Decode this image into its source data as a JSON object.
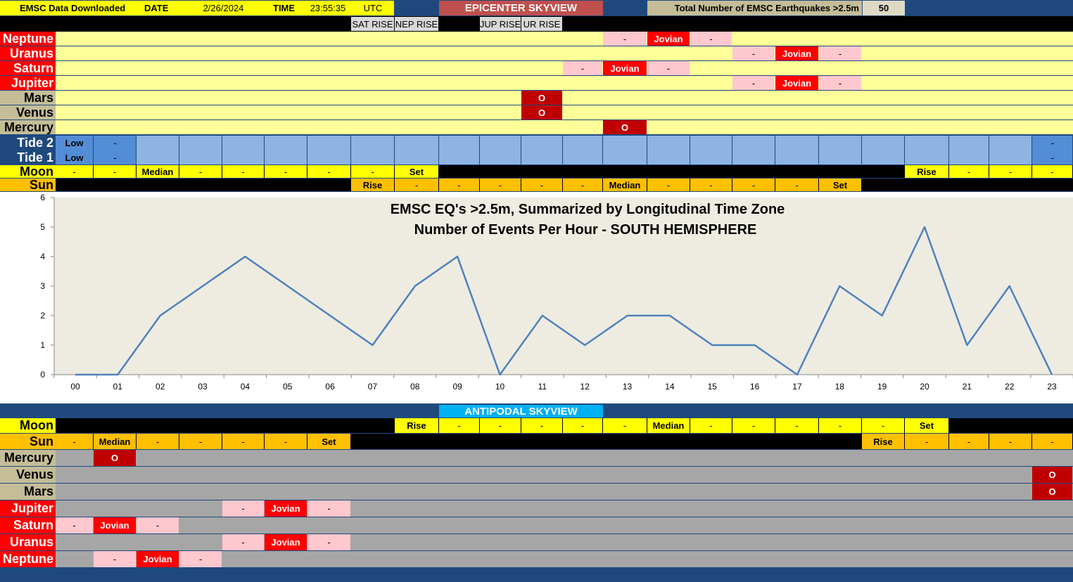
{
  "header": {
    "downloaded_label": "EMSC Data Downloaded",
    "date_label": "DATE",
    "date_value": "2/26/2024",
    "time_label": "TIME",
    "time_value": "23:55:35",
    "tz": "UTC",
    "title": "EPICENTER SKYVIEW",
    "total_label": "Total Number of EMSC Earthquakes >2.5m",
    "total_value": "50"
  },
  "rise_labels": [
    {
      "text": "SAT RISE",
      "col": 7
    },
    {
      "text": "NEP RISE",
      "col": 8
    },
    {
      "text": "JUP RISE",
      "col": 10
    },
    {
      "text": "UR RISE",
      "col": 11
    }
  ],
  "colors": {
    "navy": "#1F497D",
    "planet_red": "#FF0000",
    "tan": "#C4BD97",
    "band_yellow": "#FFFF99",
    "jovian_pink": "#FFC7CE",
    "conj_red": "#C00000",
    "tide_blue": "#8DB4E2",
    "tide_dark": "#538DD5",
    "moon_yellow": "#FFFF00",
    "sun_orange": "#FFC000",
    "antipodal_gray": "#A6A6A6",
    "antipodal_title": "#00B0F0",
    "line": "#4F81BD"
  },
  "epicenter": {
    "planets": [
      {
        "label": "Neptune",
        "cells": [
          {
            "col": 13,
            "text": "-",
            "kind": "pink"
          },
          {
            "col": 14,
            "text": "Jovian",
            "kind": "red"
          },
          {
            "col": 15,
            "text": "-",
            "kind": "pink"
          }
        ]
      },
      {
        "label": "Uranus",
        "cells": [
          {
            "col": 16,
            "text": "-",
            "kind": "pink"
          },
          {
            "col": 17,
            "text": "Jovian",
            "kind": "red"
          },
          {
            "col": 18,
            "text": "-",
            "kind": "pink"
          }
        ]
      },
      {
        "label": "Saturn",
        "cells": [
          {
            "col": 12,
            "text": "-",
            "kind": "pink"
          },
          {
            "col": 13,
            "text": "Jovian",
            "kind": "red"
          },
          {
            "col": 14,
            "text": "-",
            "kind": "pink"
          }
        ]
      },
      {
        "label": "Jupiter",
        "cells": [
          {
            "col": 16,
            "text": "-",
            "kind": "pink"
          },
          {
            "col": 17,
            "text": "Jovian",
            "kind": "red"
          },
          {
            "col": 18,
            "text": "-",
            "kind": "pink"
          }
        ]
      },
      {
        "label": "Mars",
        "cells": [
          {
            "col": 11,
            "text": "O",
            "kind": "conj"
          }
        ]
      },
      {
        "label": "Venus",
        "cells": [
          {
            "col": 11,
            "text": "O",
            "kind": "conj"
          }
        ]
      },
      {
        "label": "Mercury",
        "cells": [
          {
            "col": 13,
            "text": "O",
            "kind": "conj"
          }
        ]
      }
    ],
    "tide2_label": "Tide 2",
    "tide1_label": "Tide 1",
    "tide_low": "Low",
    "tide_dash_cols": [
      1,
      23
    ],
    "moon_label": "Moon",
    "moon": [
      "-",
      "-",
      "Median",
      "-",
      "-",
      "-",
      "-",
      "-",
      "Set",
      "",
      "",
      "",
      "",
      "",
      "",
      "",
      "",
      "",
      "",
      "",
      "Rise",
      "-",
      "-",
      "-"
    ],
    "sun_label": "Sun",
    "sun": [
      "",
      "",
      "",
      "",
      "",
      "",
      "",
      "Rise",
      "-",
      "-",
      "-",
      "-",
      "-",
      "Median",
      "-",
      "-",
      "-",
      "-",
      "Set",
      "",
      "",
      "",
      "",
      ""
    ]
  },
  "chart_data": {
    "type": "line",
    "title": "EMSC EQ's >2.5m, Summarized by Longitudinal Time Zone",
    "subtitle": "Number of Events Per Hour - SOUTH HEMISPHERE",
    "categories": [
      "00",
      "01",
      "02",
      "03",
      "04",
      "05",
      "06",
      "07",
      "08",
      "09",
      "10",
      "11",
      "12",
      "13",
      "14",
      "15",
      "16",
      "17",
      "18",
      "19",
      "20",
      "21",
      "22",
      "23"
    ],
    "values": [
      0,
      0,
      2,
      3,
      4,
      3,
      2,
      1,
      3,
      4,
      0,
      2,
      1,
      2,
      2,
      1,
      1,
      0,
      3,
      2,
      5,
      1,
      3,
      0
    ],
    "yticks": [
      "0",
      "1",
      "2",
      "3",
      "4",
      "5",
      "6"
    ],
    "ylim": [
      0,
      6
    ],
    "grid": false,
    "legend": "none"
  },
  "antipodal": {
    "title": "ANTIPODAL SKYVIEW",
    "moon_label": "Moon",
    "moon": [
      "",
      "",
      "",
      "",
      "",
      "",
      "",
      "",
      "Rise",
      "-",
      "-",
      "-",
      "-",
      "-",
      "Median",
      "-",
      "-",
      "-",
      "-",
      "-",
      "Set",
      "",
      "",
      ""
    ],
    "sun_label": "Sun",
    "sun": [
      "-",
      "Median",
      "-",
      "-",
      "-",
      "-",
      "Set",
      "",
      "",
      "",
      "",
      "",
      "",
      "",
      "",
      "",
      "",
      "",
      "",
      "Rise",
      "-",
      "-",
      "-",
      "-"
    ],
    "planets": [
      {
        "label": "Mercury",
        "cells": [
          {
            "col": 1,
            "text": "O",
            "kind": "conj"
          }
        ]
      },
      {
        "label": "Venus",
        "cells": [
          {
            "col": 23,
            "text": "O",
            "kind": "conj"
          }
        ]
      },
      {
        "label": "Mars",
        "cells": [
          {
            "col": 23,
            "text": "O",
            "kind": "conj"
          }
        ]
      },
      {
        "label": "Jupiter",
        "cells": [
          {
            "col": 4,
            "text": "-",
            "kind": "pink"
          },
          {
            "col": 5,
            "text": "Jovian",
            "kind": "red"
          },
          {
            "col": 6,
            "text": "-",
            "kind": "pink"
          }
        ]
      },
      {
        "label": "Saturn",
        "cells": [
          {
            "col": 0,
            "text": "-",
            "kind": "pink"
          },
          {
            "col": 1,
            "text": "Jovian",
            "kind": "red"
          },
          {
            "col": 2,
            "text": "-",
            "kind": "pink"
          }
        ]
      },
      {
        "label": "Uranus",
        "cells": [
          {
            "col": 4,
            "text": "-",
            "kind": "pink"
          },
          {
            "col": 5,
            "text": "Jovian",
            "kind": "red"
          },
          {
            "col": 6,
            "text": "-",
            "kind": "pink"
          }
        ]
      },
      {
        "label": "Neptune",
        "cells": [
          {
            "col": 1,
            "text": "-",
            "kind": "pink"
          },
          {
            "col": 2,
            "text": "Jovian",
            "kind": "red"
          },
          {
            "col": 3,
            "text": "-",
            "kind": "pink"
          }
        ]
      }
    ]
  }
}
